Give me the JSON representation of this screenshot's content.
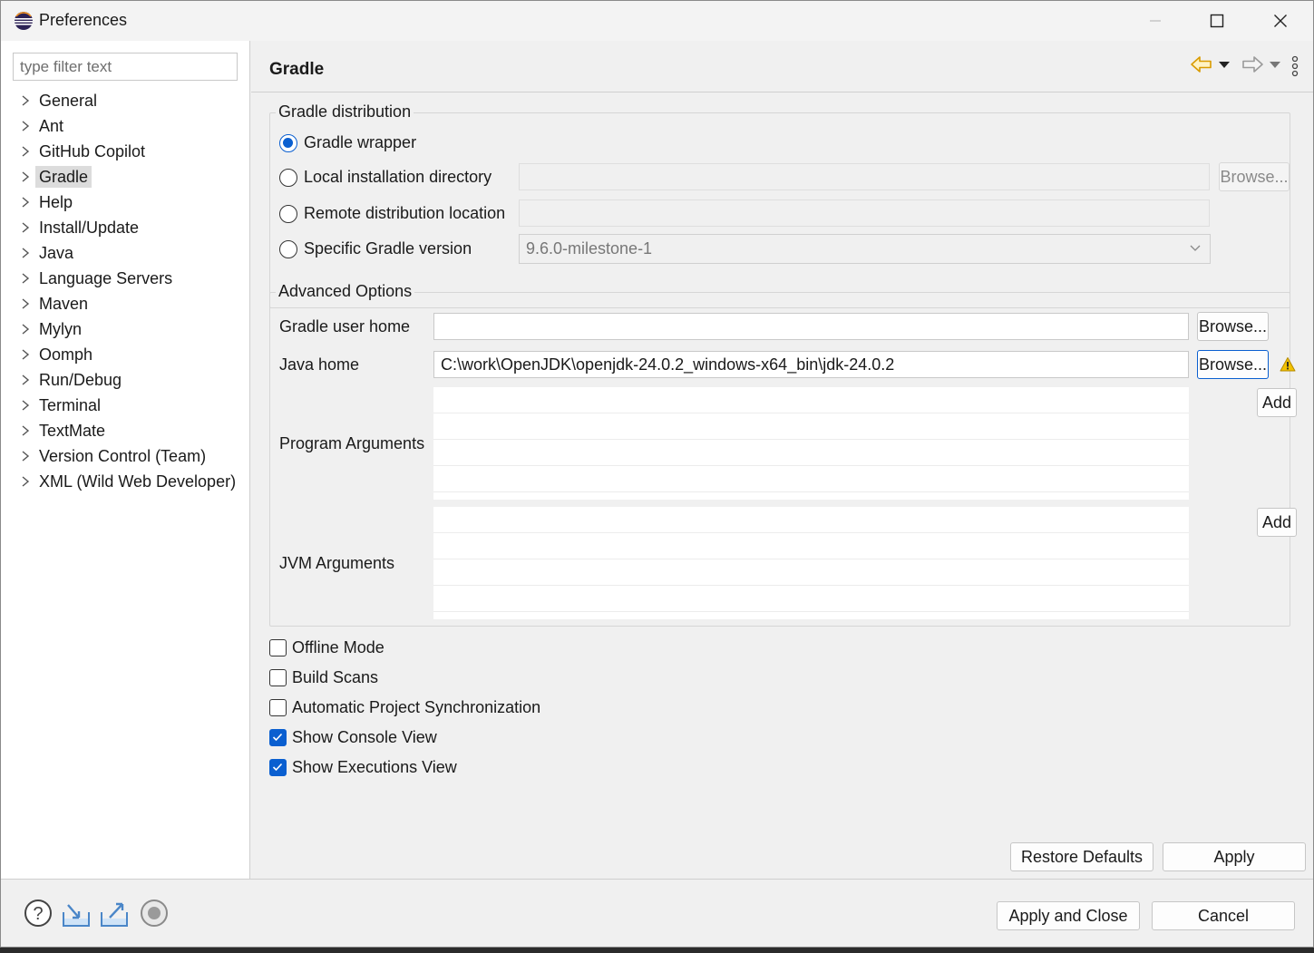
{
  "window": {
    "title": "Preferences"
  },
  "sidebar": {
    "filter_placeholder": "type filter text",
    "items": [
      {
        "label": "General"
      },
      {
        "label": "Ant"
      },
      {
        "label": "GitHub Copilot"
      },
      {
        "label": "Gradle",
        "selected": true
      },
      {
        "label": "Help"
      },
      {
        "label": "Install/Update"
      },
      {
        "label": "Java"
      },
      {
        "label": "Language Servers"
      },
      {
        "label": "Maven"
      },
      {
        "label": "Mylyn"
      },
      {
        "label": "Oomph"
      },
      {
        "label": "Run/Debug"
      },
      {
        "label": "Terminal"
      },
      {
        "label": "TextMate"
      },
      {
        "label": "Version Control (Team)"
      },
      {
        "label": "XML (Wild Web Developer)"
      }
    ]
  },
  "page": {
    "title": "Gradle",
    "nav_icons": [
      "back-arrow-icon",
      "dropdown-icon",
      "forward-arrow-icon",
      "dropdown-icon",
      "more-vertical-icon"
    ]
  },
  "distribution": {
    "legend": "Gradle distribution",
    "wrapper_label": "Gradle wrapper",
    "local_label": "Local installation directory",
    "local_value": "",
    "local_browse": "Browse...",
    "remote_label": "Remote distribution location",
    "remote_value": "",
    "version_label": "Specific Gradle version",
    "version_value": "9.6.0-milestone-1",
    "selected": "wrapper"
  },
  "advanced": {
    "legend": "Advanced Options",
    "user_home_label": "Gradle user home",
    "user_home_value": "",
    "user_home_browse": "Browse...",
    "java_home_label": "Java home",
    "java_home_value": "C:\\work\\OpenJDK\\openjdk-24.0.2_windows-x64_bin\\jdk-24.0.2",
    "java_home_browse": "Browse...",
    "program_args_label": "Program Arguments",
    "program_args_add": "Add",
    "jvm_args_label": "JVM Arguments",
    "jvm_args_add": "Add"
  },
  "options": {
    "offline": {
      "label": "Offline Mode",
      "checked": false
    },
    "build_scans": {
      "label": "Build Scans",
      "checked": false
    },
    "auto_sync": {
      "label": "Automatic Project Synchronization",
      "checked": false
    },
    "console_view": {
      "label": "Show Console View",
      "checked": true
    },
    "executions_view": {
      "label": "Show Executions View",
      "checked": true
    }
  },
  "page_buttons": {
    "restore_defaults": "Restore Defaults",
    "apply": "Apply"
  },
  "footer": {
    "icons": [
      "help-icon",
      "import-icon",
      "export-icon",
      "record-icon"
    ],
    "apply_and_close": "Apply and Close",
    "cancel": "Cancel"
  },
  "colors": {
    "accent": "#0a5fd0",
    "warning": "#f2c200",
    "back_arrow": "#e0a000"
  }
}
